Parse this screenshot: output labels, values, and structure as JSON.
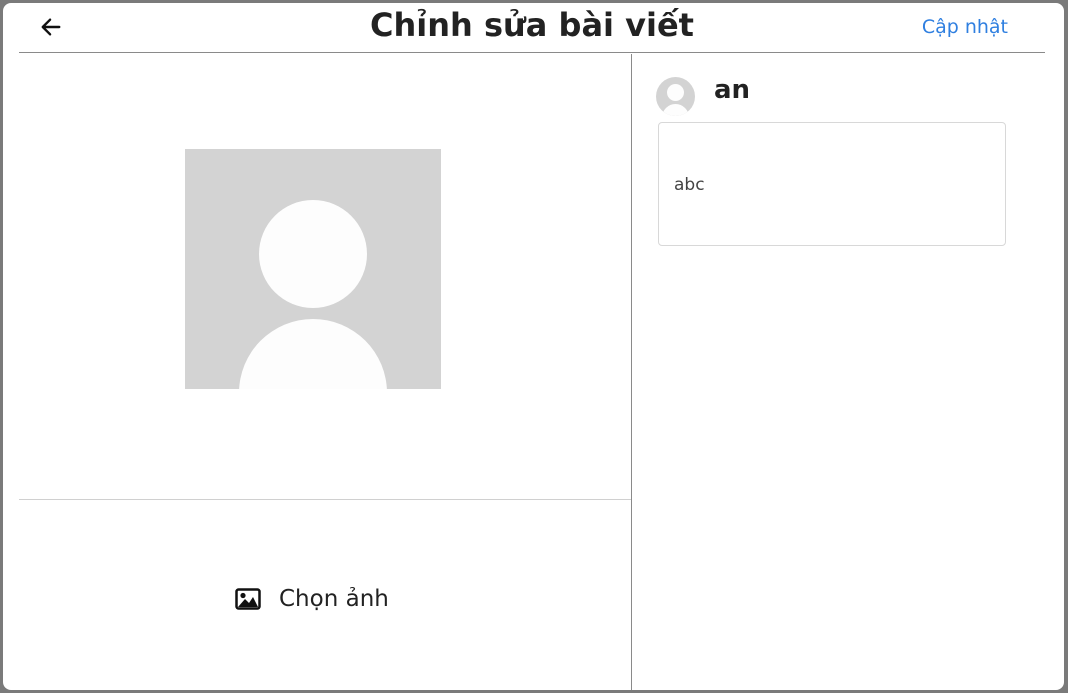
{
  "header": {
    "title": "Chỉnh sửa bài viết",
    "back_icon": "arrow-left-icon",
    "update_label": "Cập nhật"
  },
  "left": {
    "preview_icon": "avatar-placeholder-icon",
    "choose_icon": "image-icon",
    "choose_label": "Chọn ảnh"
  },
  "right": {
    "username": "an",
    "post_text": "abc"
  },
  "colors": {
    "accent": "#2f7fe0",
    "placeholder": "#d3d3d3"
  }
}
